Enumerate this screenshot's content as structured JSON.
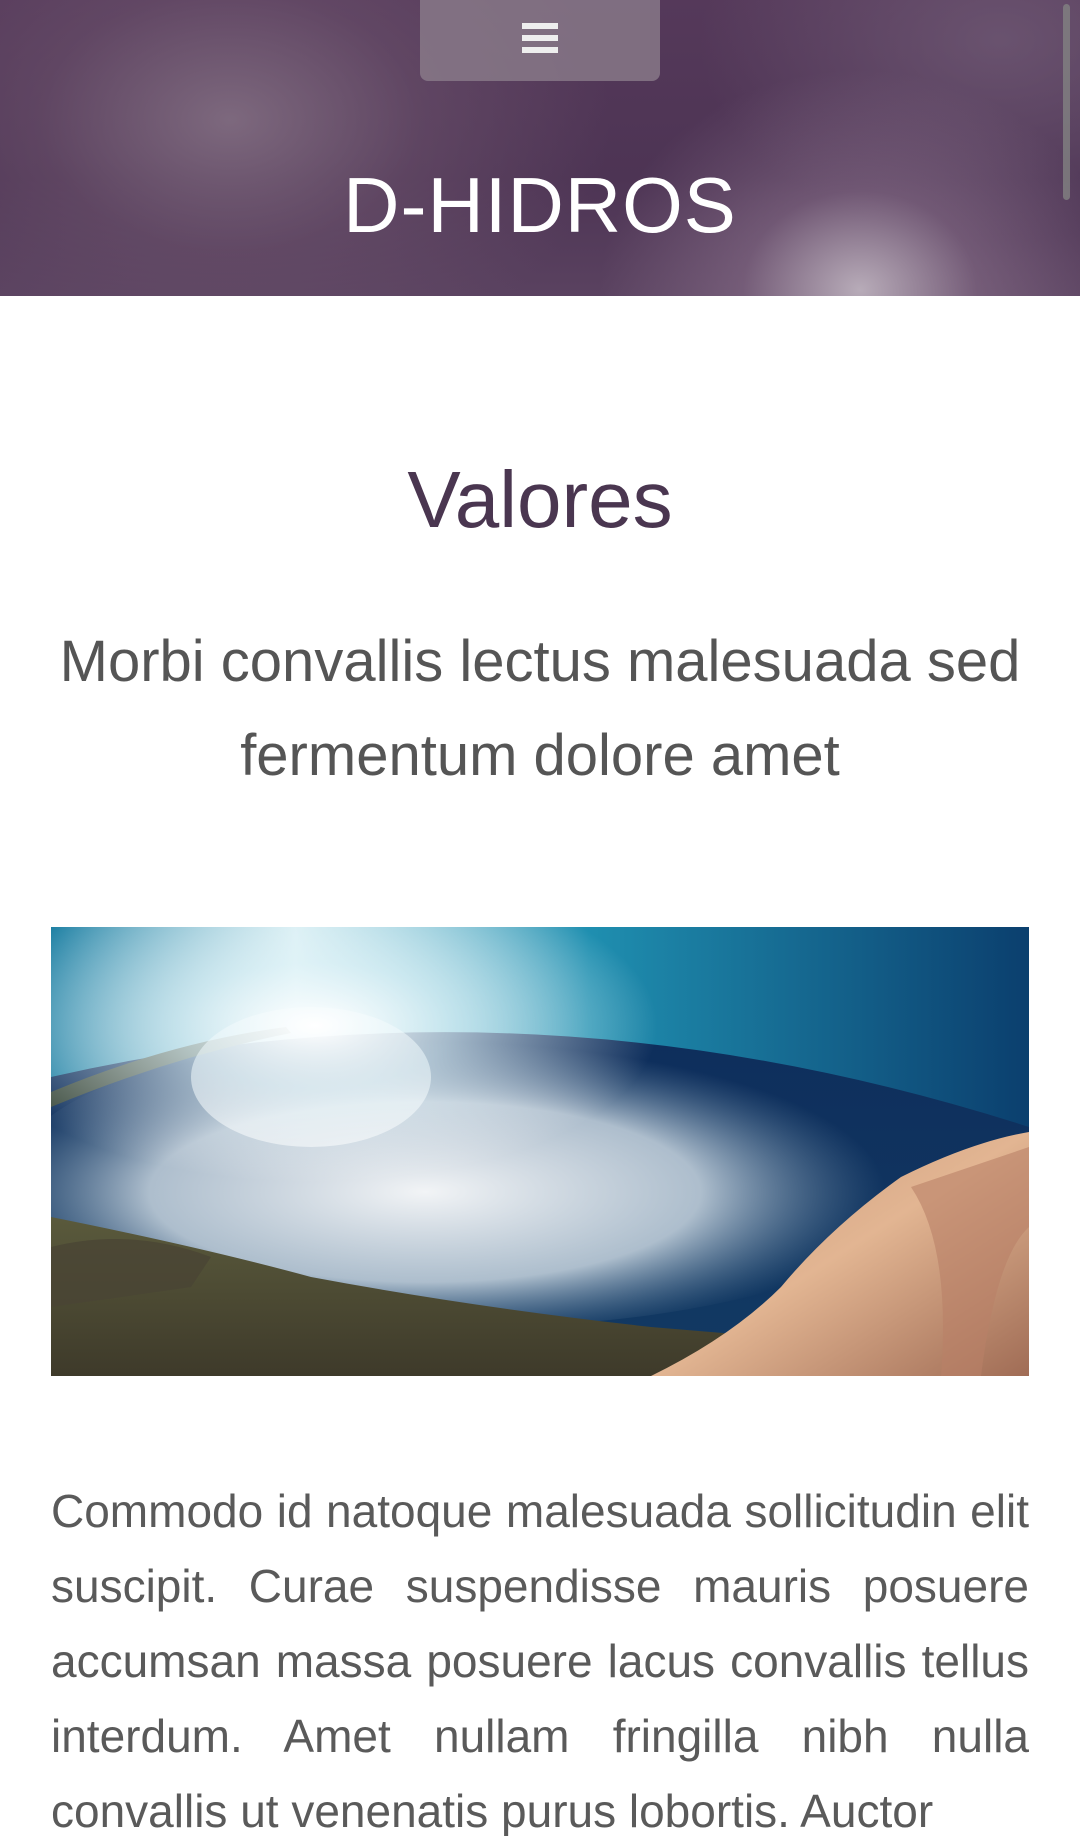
{
  "header": {
    "menu_icon": "hamburger-menu-icon",
    "site_title": "D-HIDROS"
  },
  "section": {
    "title": "Valores",
    "subtitle": "Morbi convallis lectus malesuada sed fermentum dolore amet",
    "image_icon": "ocean-fisheye-photo",
    "body": "Commodo id natoque malesuada sollicitudin elit suscipit. Curae suspendisse mauris posuere accumsan massa posuere lacus convallis tellus interdum. Amet nullam fringilla nibh nulla convallis ut venenatis purus lobortis. Auctor"
  },
  "colors": {
    "banner": "#4d3454",
    "title": "#4a3650",
    "text": "#5a5a5a"
  }
}
